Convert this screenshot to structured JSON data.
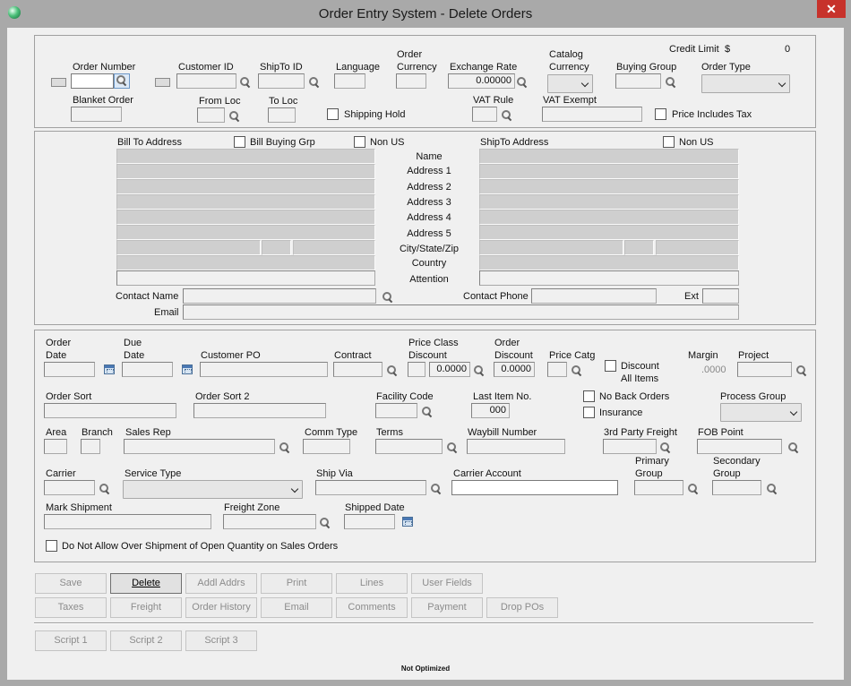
{
  "window": {
    "title": "Order Entry System - Delete Orders",
    "close_glyph": "✕"
  },
  "header": {
    "order_number_label": "Order Number",
    "customer_id_label": "Customer ID",
    "shipto_id_label": "ShipTo ID",
    "language_label": "Language",
    "order_currency_label": "Order\nCurrency",
    "exchange_rate_label": "Exchange Rate",
    "exchange_rate_value": "0.00000",
    "catalog_currency_label": "Catalog\nCurrency",
    "buying_group_label": "Buying Group",
    "order_type_label": "Order Type",
    "credit_limit_label": "Credit Limit",
    "credit_limit_currency": "$",
    "credit_limit_value": "0",
    "blanket_order_label": "Blanket Order",
    "from_loc_label": "From Loc",
    "to_loc_label": "To Loc",
    "shipping_hold_label": "Shipping Hold",
    "vat_rule_label": "VAT Rule",
    "vat_exempt_label": "VAT Exempt",
    "price_includes_tax_label": "Price Includes Tax"
  },
  "address": {
    "bill_to_label": "Bill To Address",
    "bill_buying_grp_label": "Bill Buying Grp",
    "non_us_label": "Non US",
    "ship_to_label": "ShipTo Address",
    "ship_non_us_label": "Non US",
    "row_labels": [
      "Name",
      "Address 1",
      "Address 2",
      "Address 3",
      "Address 4",
      "Address 5",
      "City/State/Zip",
      "Country",
      "Attention"
    ],
    "contact_name_label": "Contact Name",
    "contact_phone_label": "Contact Phone",
    "ext_label": "Ext",
    "email_label": "Email"
  },
  "details": {
    "order_date_label": "Order\nDate",
    "due_date_label": "Due\nDate",
    "customer_po_label": "Customer PO",
    "contract_label": "Contract",
    "price_class_discount_label": "Price Class\nDiscount",
    "price_class_discount_value": "0.0000",
    "order_discount_label": "Order\nDiscount",
    "order_discount_value": "0.0000",
    "price_catg_label": "Price Catg",
    "discount_all_items_label": "Discount\nAll Items",
    "margin_label": "Margin",
    "margin_value": ".0000",
    "project_label": "Project",
    "order_sort_label": "Order Sort",
    "order_sort2_label": "Order Sort 2",
    "facility_code_label": "Facility Code",
    "last_item_no_label": "Last Item No.",
    "last_item_no_value": "000",
    "no_back_orders_label": "No Back Orders",
    "insurance_label": "Insurance",
    "process_group_label": "Process Group",
    "area_label": "Area",
    "branch_label": "Branch",
    "sales_rep_label": "Sales Rep",
    "comm_type_label": "Comm Type",
    "terms_label": "Terms",
    "waybill_number_label": "Waybill Number",
    "third_party_freight_label": "3rd Party Freight",
    "fob_point_label": "FOB Point",
    "carrier_label": "Carrier",
    "service_type_label": "Service Type",
    "ship_via_label": "Ship Via",
    "carrier_account_label": "Carrier Account",
    "primary_group_label": "Primary\nGroup",
    "secondary_group_label": "Secondary\nGroup",
    "mark_shipment_label": "Mark Shipment",
    "freight_zone_label": "Freight Zone",
    "shipped_date_label": "Shipped Date",
    "no_over_shipment_label": "Do Not Allow Over Shipment of Open Quantity on Sales Orders"
  },
  "buttons": {
    "save": "Save",
    "delete": "Delete",
    "addl_addrs": "Addl Addrs",
    "print": "Print",
    "lines": "Lines",
    "user_fields": "User Fields",
    "taxes": "Taxes",
    "freight": "Freight",
    "order_history": "Order History",
    "email": "Email",
    "comments": "Comments",
    "payment": "Payment",
    "drop_pos": "Drop POs",
    "script1": "Script 1",
    "script2": "Script 2",
    "script3": "Script 3"
  },
  "status": {
    "text": "Not Optimized"
  },
  "colors": {
    "titlebar": "#a9a9a9",
    "client": "#f0f0f0",
    "close": "#c7322b"
  }
}
